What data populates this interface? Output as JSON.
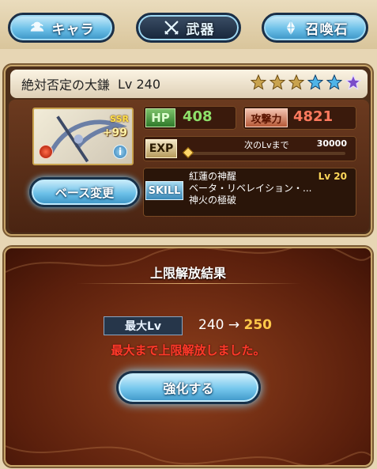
{
  "tabs": {
    "chara_label": "キャラ",
    "weapon_label": "武器",
    "summon_label": "召喚石"
  },
  "weapon": {
    "name": "絶対否定の大鎌",
    "level_text": "Lv 240",
    "rarity": "SSR",
    "plus": "+99",
    "stars": [
      "gold",
      "gold",
      "gold",
      "blue",
      "blue",
      "purple"
    ],
    "hp_label": "HP",
    "hp": "408",
    "atk_label": "攻撃力",
    "atk": "4821",
    "exp_label": "EXP",
    "exp_next_label": "次のLvまで",
    "exp_next_value": "30000",
    "exp_progress": 0.0,
    "skill_label": "SKILL",
    "skill_lines": [
      "紅蓮の神醒",
      "ベータ・リベレイション・...",
      "神火の極破"
    ],
    "skill_level": "Lv 20"
  },
  "base_change_label": "ベース変更",
  "result": {
    "title": "上限解放結果",
    "max_lv_label": "最大Lv",
    "from_lv": "240",
    "arrow": "→",
    "to_lv": "250",
    "message": "最大まで上限解放しました。",
    "enhance_label": "強化する"
  },
  "colors": {
    "tab_active": "#16253a",
    "hp_value": "#8ee06a",
    "atk_value": "#ff7a5e",
    "skill_level": "#ffd75a",
    "message": "#ff3a2a",
    "to_lv": "#ffc94a"
  }
}
